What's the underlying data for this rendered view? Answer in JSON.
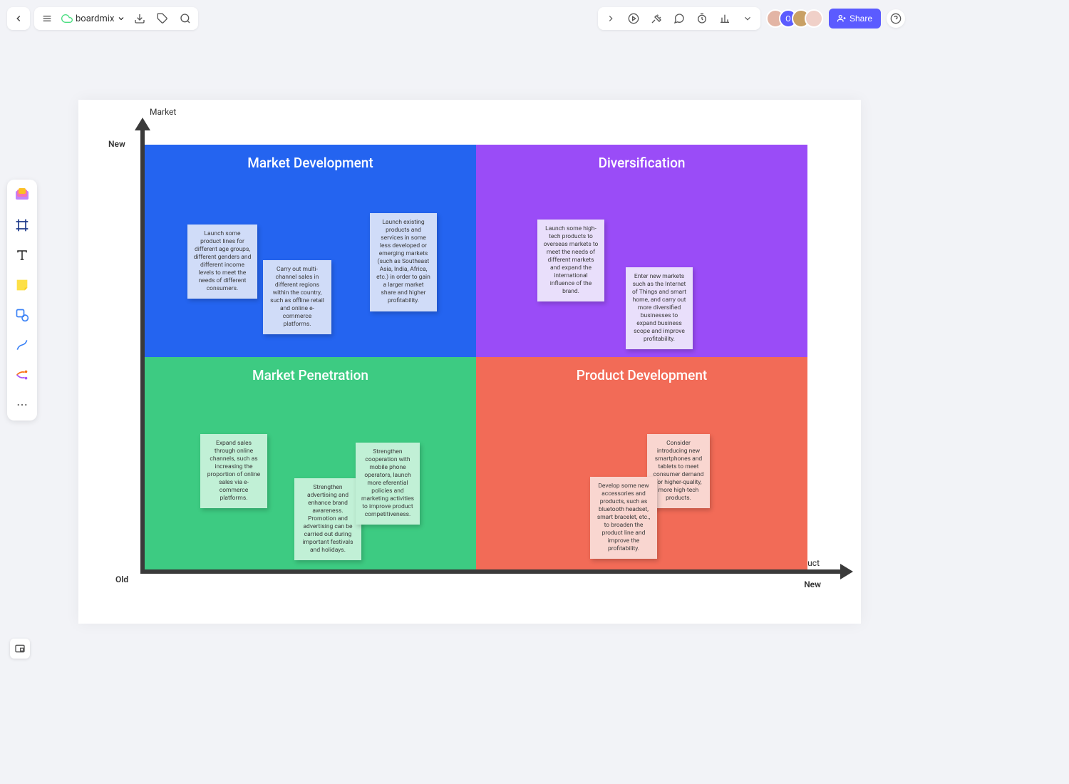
{
  "header": {
    "doc_title": "boardmix",
    "share_label": "Share"
  },
  "avatars": {
    "a1_bg": "#e3b5a5",
    "a2_bg": "#5b5bff",
    "a2_letter": "O",
    "a3_bg": "#c9a064",
    "a4_bg": "#f0d0c8"
  },
  "axes": {
    "y_dimension": "Market",
    "y_new": "New",
    "y_old": "Old",
    "x_dimension": "Product",
    "x_new": "New"
  },
  "quadrants": {
    "md": {
      "title": "Market Development",
      "note1": "Launch some product lines for different age groups, different genders and different income levels to meet the needs of different consumers.",
      "note2": "Carry out multi-channel sales in different regions within the country, such as offline retail and online e-commerce platforms.",
      "note3": "Launch existing products and services in some less developed or emerging markets (such as Southeast Asia, India, Africa, etc.) in order to gain a larger market share and higher profitability."
    },
    "div": {
      "title": "Diversification",
      "note1": "Launch some high-tech products to overseas markets to meet the needs of different markets and expand the international influence of the brand.",
      "note2": "Enter new markets such as the Internet of Things and smart home, and carry out more diversified businesses to expand business scope and improve profitability."
    },
    "mp": {
      "title": "Market Penetration",
      "note1": "Expand sales through online channels, such as increasing the proportion of online sales via e-commerce platforms.",
      "note2": "Strengthen advertising and enhance brand awareness. Promotion and advertising can be carried out during important festivals and holidays.",
      "note3": "Strengthen cooperation with mobile phone operators, launch more eferential policies and marketing activities to improve product competitiveness."
    },
    "pd": {
      "title": "Product Development",
      "note1": "Consider introducing new smartphones and tablets to meet consumer demand for higher-quality, more high-tech products.",
      "note2": "Develop some new accessories and products, such as bluetooth headset, smart bracelet, etc., to broaden the product line and improve the profitability."
    }
  }
}
